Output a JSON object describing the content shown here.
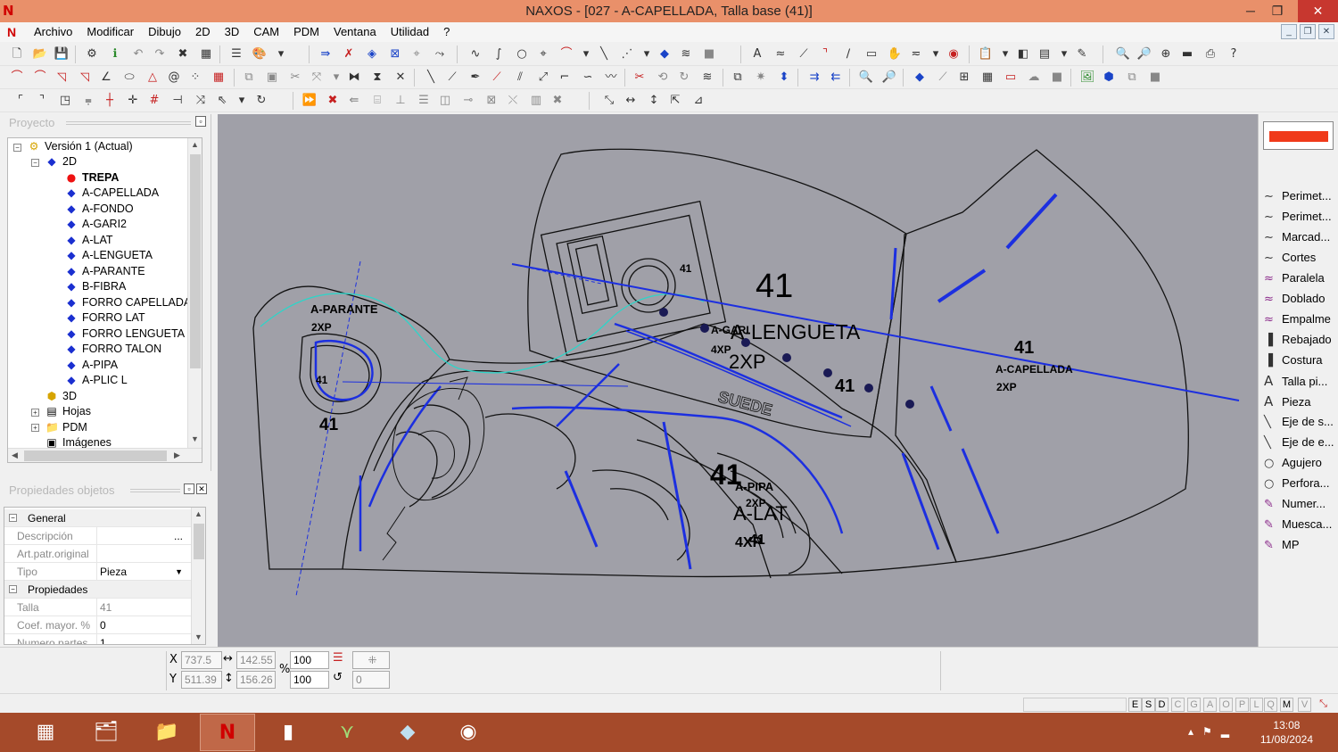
{
  "titlebar": {
    "title": "NAXOS - [027 - A-CAPELLADA, Talla base (41)]",
    "minimize": "─",
    "restore": "❐",
    "close": "✕"
  },
  "menu": [
    "Archivo",
    "Modificar",
    "Dibujo",
    "2D",
    "3D",
    "CAM",
    "PDM",
    "Ventana",
    "Utilidad",
    "?"
  ],
  "project_panel": {
    "title": "Proyecto",
    "tree": [
      {
        "label": "Versión 1 (Actual)",
        "icon": "folder-gear-icon"
      },
      {
        "label": "2D",
        "icon": "diamond-icon"
      },
      {
        "label": "TREPA",
        "icon": "red-dot-icon"
      },
      {
        "label": "A-CAPELLADA",
        "icon": "diamond-icon"
      },
      {
        "label": "A-FONDO",
        "icon": "diamond-icon"
      },
      {
        "label": "A-GARI2",
        "icon": "diamond-icon"
      },
      {
        "label": "A-LAT",
        "icon": "diamond-icon"
      },
      {
        "label": "A-LENGUETA",
        "icon": "diamond-icon"
      },
      {
        "label": "A-PARANTE",
        "icon": "diamond-icon"
      },
      {
        "label": "B-FIBRA",
        "icon": "diamond-icon"
      },
      {
        "label": "FORRO CAPELLADA",
        "icon": "diamond-icon"
      },
      {
        "label": "FORRO LAT",
        "icon": "diamond-icon"
      },
      {
        "label": "FORRO LENGUETA",
        "icon": "diamond-icon"
      },
      {
        "label": "FORRO TALON",
        "icon": "diamond-icon"
      },
      {
        "label": "A-PIPA",
        "icon": "diamond-icon"
      },
      {
        "label": "A-PLIC L",
        "icon": "diamond-icon"
      },
      {
        "label": "3D",
        "icon": "cube-icon"
      },
      {
        "label": "Hojas",
        "icon": "sheet-icon"
      },
      {
        "label": "PDM",
        "icon": "folder-icon"
      },
      {
        "label": "Imágenes",
        "icon": "image-icon"
      }
    ]
  },
  "properties_panel": {
    "title": "Propiedades objetos",
    "rows": [
      {
        "key": "General",
        "value": "",
        "section": true
      },
      {
        "key": "Descripción",
        "value": "",
        "button": "..."
      },
      {
        "key": "Art.patr.original",
        "value": ""
      },
      {
        "key": "Tipo",
        "value": "Pieza",
        "dropdown": true
      },
      {
        "key": "Propiedades",
        "value": "",
        "section": true
      },
      {
        "key": "Talla",
        "value": "41"
      },
      {
        "key": "Coef. mayor. %",
        "value": "0"
      },
      {
        "key": "Numero partes",
        "value": "1"
      }
    ]
  },
  "canvas_labels": {
    "size_41_main": "41",
    "lengueta": "A-LENGUETA",
    "lengueta_qty": "2XP",
    "capellada_size": "41",
    "capellada": "A-CAPELLADA",
    "capellada_qty": "2XP",
    "parante": "A-PARANTE",
    "parante_qty": "2XP",
    "parante_size_small": "41",
    "parante_size": "41",
    "gari": "A-GARI",
    "gari_qty": "4XP",
    "size_41_mid": "41",
    "size_41_logo": "41",
    "pipa": "A-PIPA",
    "pipa_qty": "2XP",
    "lat": "A-LAT",
    "lat_qty": "4XP",
    "lat_size": "41",
    "lat_size_big": "41",
    "suede": "SUEDE"
  },
  "right_tools": [
    {
      "label": "Perimet...",
      "icon": "curve-icon"
    },
    {
      "label": "Perimet...",
      "icon": "curve-icon"
    },
    {
      "label": "Marcad...",
      "icon": "curve-icon"
    },
    {
      "label": "Cortes",
      "icon": "curve-icon"
    },
    {
      "label": "Paralela",
      "icon": "parallel-curve-icon"
    },
    {
      "label": "Doblado",
      "icon": "parallel-curve-icon"
    },
    {
      "label": "Empalme",
      "icon": "parallel-curve-icon"
    },
    {
      "label": "Rebajado",
      "icon": "skive-icon"
    },
    {
      "label": "Costura",
      "icon": "stitch-icon"
    },
    {
      "label": "Talla pi...",
      "icon": "text-a-icon"
    },
    {
      "label": "Pieza",
      "icon": "text-a-icon"
    },
    {
      "label": "Eje de s...",
      "icon": "axis-icon"
    },
    {
      "label": "Eje de e...",
      "icon": "axis-icon"
    },
    {
      "label": "Agujero",
      "icon": "circle-icon"
    },
    {
      "label": "Perfora...",
      "icon": "circle-icon"
    },
    {
      "label": "Numer...",
      "icon": "pen-icon"
    },
    {
      "label": "Muesca...",
      "icon": "pen-icon"
    },
    {
      "label": "MP",
      "icon": "pen-icon"
    }
  ],
  "coords": {
    "x_label": "X",
    "y_label": "Y",
    "x": "737.5",
    "y": "511.39",
    "w": "142.55",
    "h": "156.26",
    "pct_label": "%",
    "scale_x": "100",
    "scale_y": "100",
    "rotation": "0"
  },
  "status_flags": [
    "E",
    "S",
    "D",
    "C",
    "G",
    "A",
    "O",
    "P",
    "L",
    "Q",
    "M",
    "V"
  ],
  "taskbar": {
    "time": "13:08",
    "date": "11/08/2024"
  }
}
